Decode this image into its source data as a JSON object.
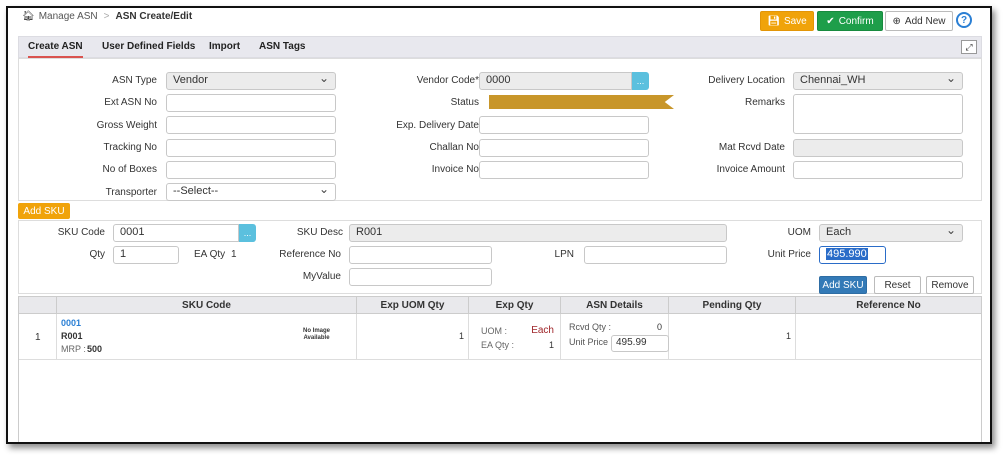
{
  "breadcrumb": {
    "home": "Manage ASN",
    "current": "ASN Create/Edit"
  },
  "toolbar": {
    "save": "Save",
    "confirm": "Confirm",
    "add_new": "Add New",
    "help": "?"
  },
  "tabs": [
    {
      "label": "Create ASN",
      "active": true
    },
    {
      "label": "User Defined Fields",
      "active": false
    },
    {
      "label": "Import",
      "active": false
    },
    {
      "label": "ASN Tags",
      "active": false
    }
  ],
  "form": {
    "asn_type": {
      "label": "ASN Type",
      "value": "Vendor"
    },
    "ext_asn_no": {
      "label": "Ext ASN No",
      "value": ""
    },
    "gross_weight": {
      "label": "Gross Weight",
      "value": ""
    },
    "tracking_no": {
      "label": "Tracking No",
      "value": ""
    },
    "no_of_boxes": {
      "label": "No of Boxes",
      "value": ""
    },
    "transporter": {
      "label": "Transporter",
      "value": "--Select--"
    },
    "vendor_code": {
      "label": "Vendor Code*",
      "value": "0000"
    },
    "status": {
      "label": "Status",
      "value": ""
    },
    "exp_delivery_date": {
      "label": "Exp. Delivery Date",
      "value": ""
    },
    "challan_no": {
      "label": "Challan No",
      "value": ""
    },
    "invoice_no": {
      "label": "Invoice No",
      "value": ""
    },
    "delivery_location": {
      "label": "Delivery Location",
      "value": "Chennai_WH"
    },
    "remarks": {
      "label": "Remarks",
      "value": ""
    },
    "mat_rcvd_date": {
      "label": "Mat Rcvd Date",
      "value": ""
    },
    "invoice_amount": {
      "label": "Invoice Amount",
      "value": ""
    },
    "lookup_dots": "..."
  },
  "add_sku": {
    "button": "Add SKU",
    "sku_code": {
      "label": "SKU Code",
      "value": "0001"
    },
    "sku_desc": {
      "label": "SKU Desc",
      "value": "R001"
    },
    "uom": {
      "label": "UOM",
      "value": "Each"
    },
    "qty": {
      "label": "Qty",
      "value": "1"
    },
    "ea_qty": {
      "label": "EA Qty",
      "value": "1"
    },
    "reference_no": {
      "label": "Reference No",
      "value": ""
    },
    "lpn": {
      "label": "LPN",
      "value": ""
    },
    "unit_price": {
      "label": "Unit Price",
      "value": "495.990"
    },
    "my_value": {
      "label": "MyValue",
      "value": ""
    },
    "add_button": "Add SKU",
    "reset_button": "Reset",
    "remove_button": "Remove"
  },
  "grid": {
    "columns": [
      "",
      "SKU Code",
      "Exp UOM Qty",
      "Exp Qty",
      "ASN Details",
      "Pending Qty",
      "Reference No"
    ],
    "rows": [
      {
        "index": "1",
        "sku_code": "0001",
        "sku_desc": "R001",
        "mrp_label": "MRP :",
        "mrp_value": "500",
        "image_text_1": "No Image",
        "image_text_2": "Available",
        "exp_uom_qty": "1",
        "uom_label": "UOM :",
        "uom_value": "Each",
        "ea_qty_label": "EA Qty :",
        "ea_qty_value": "1",
        "rcvd_qty_label": "Rcvd Qty :",
        "rcvd_qty_value": "0",
        "unit_price_label": "Unit Price :",
        "unit_price_value": "495.99",
        "pending_qty": "1",
        "reference_no": ""
      }
    ]
  },
  "colors": {
    "save": "#f0a30a",
    "confirm": "#1e9e4a",
    "status": "#c8962a",
    "link": "#2a7fd4",
    "uom": "#a0262a"
  }
}
